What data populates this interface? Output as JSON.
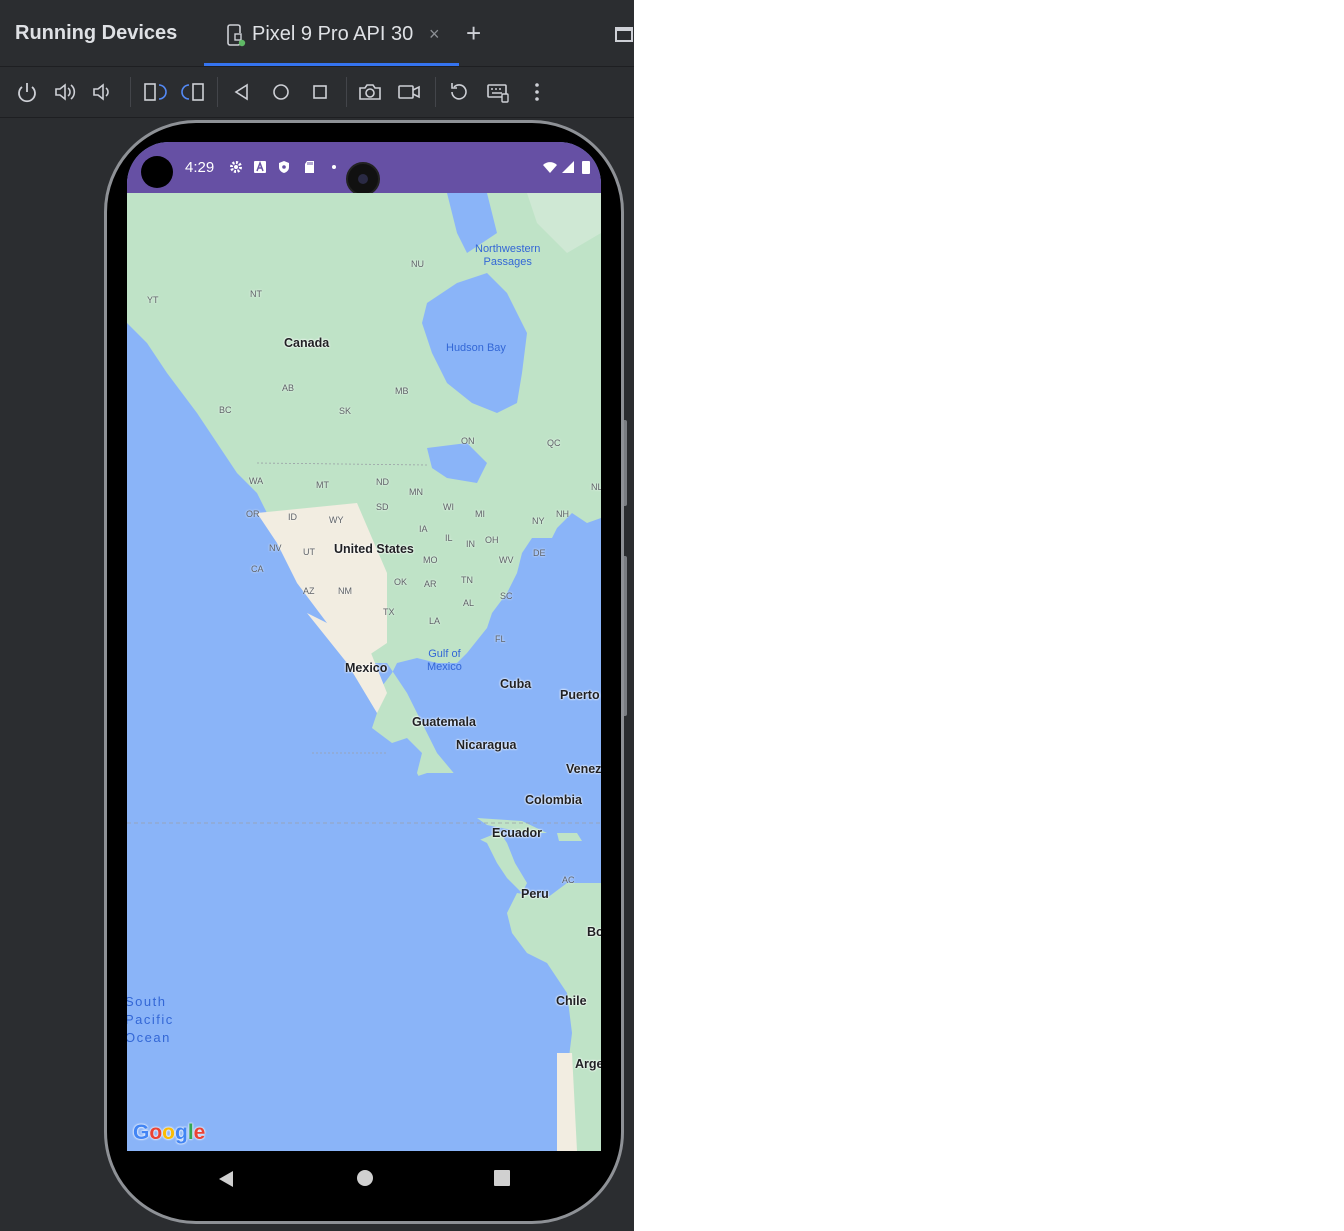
{
  "panel": {
    "title": "Running Devices",
    "tab_label": "Pixel 9 Pro API 30",
    "tab_close": "×",
    "add_tab": "+"
  },
  "toolbar": {
    "buttons": [
      "power-icon",
      "volume-up-icon",
      "volume-down-icon",
      "rotate-left-icon",
      "rotate-right-icon",
      "back-icon",
      "home-icon",
      "overview-icon",
      "camera-icon",
      "screenrecord-icon",
      "reset-icon",
      "keyboard-icon",
      "more-options-icon"
    ]
  },
  "status_bar": {
    "time": "4:29",
    "color": "#6650a4"
  },
  "map": {
    "countries": [
      "Canada",
      "United States",
      "Mexico",
      "Cuba",
      "Puerto",
      "Guatemala",
      "Nicaragua",
      "Venez",
      "Colombia",
      "Ecuador",
      "Peru",
      "Bo",
      "Chile",
      "Arge"
    ],
    "states": [
      "NU",
      "YT",
      "NT",
      "AB",
      "MB",
      "BC",
      "SK",
      "ON",
      "QC",
      "NL",
      "WA",
      "MT",
      "ND",
      "MN",
      "OR",
      "ID",
      "WY",
      "SD",
      "WI",
      "MI",
      "NY",
      "NH",
      "IA",
      "NV",
      "UT",
      "IL",
      "OH",
      "IN",
      "DE",
      "CA",
      "MO",
      "WV",
      "AZ",
      "NM",
      "OK",
      "AR",
      "TN",
      "AL",
      "SC",
      "TX",
      "LA",
      "FL",
      "AC"
    ],
    "water": {
      "northwest": "Northwestern\nPassages",
      "hudson": "Hudson Bay",
      "gulf": "Gulf of\nMexico",
      "ocean": "South\nPacific\nOcean"
    },
    "logo": "Google",
    "colors": {
      "ocean": "#8ab4f8",
      "land": "#bfe3c7",
      "desert": "#f2ede1"
    }
  }
}
